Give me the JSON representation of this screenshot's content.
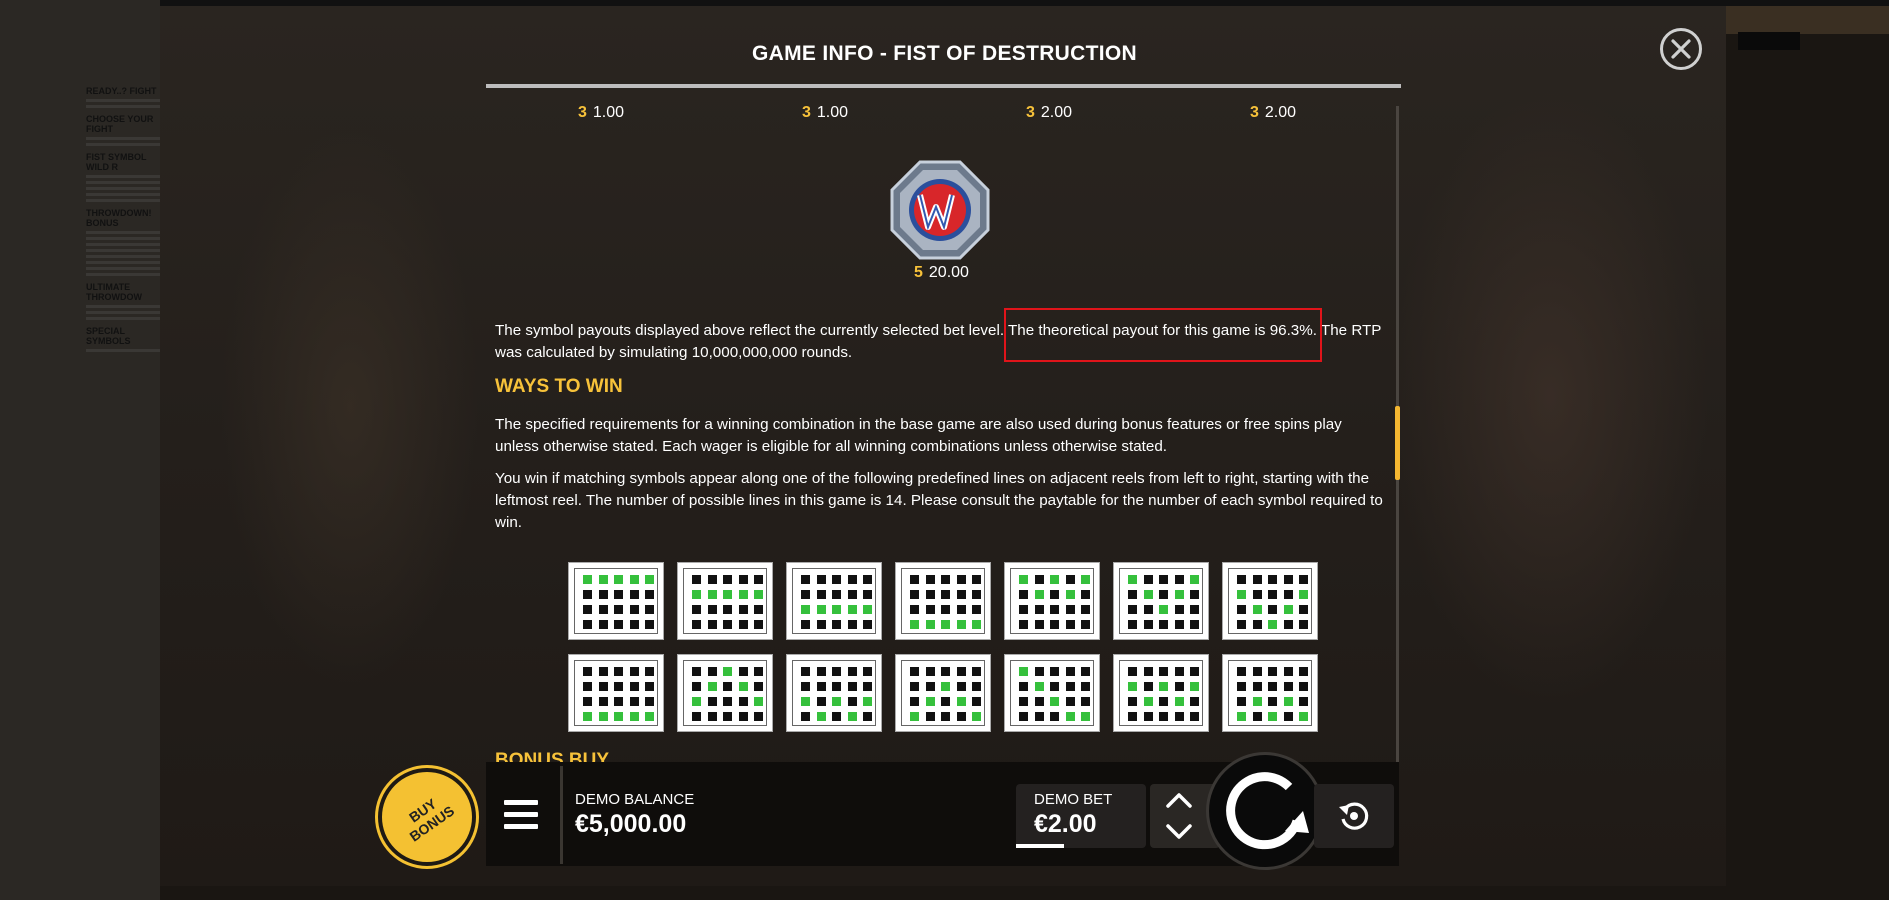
{
  "game_title": "GAME INFO - FIST OF DESTRUCTION",
  "paytable_top": [
    {
      "count": "3",
      "value": "1.00"
    },
    {
      "count": "3",
      "value": "1.00"
    },
    {
      "count": "3",
      "value": "2.00"
    },
    {
      "count": "3",
      "value": "2.00"
    }
  ],
  "wild_payout": {
    "count": "5",
    "value": "20.00"
  },
  "rtp_paragraph": "The symbol payouts displayed above reflect the currently selected bet level. The theoretical payout for this game is 96.3%. The RTP was calculated by simulating 10,000,000,000 rounds.",
  "ways_to_win": {
    "heading": "WAYS TO WIN",
    "para1": "The specified requirements for a winning combination in the base game are also used during bonus features or free spins play unless otherwise stated. Each wager is eligible for all winning combinations unless otherwise stated.",
    "para2": "You win if matching symbols appear along one of the following predefined lines on adjacent reels from left to right, starting with the leftmost reel. The number of possible lines in this game is 14. Please consult the paytable for the number of each symbol required to win."
  },
  "paylines": [
    [
      0,
      0,
      0,
      0,
      0
    ],
    [
      1,
      1,
      1,
      1,
      1
    ],
    [
      2,
      2,
      2,
      2,
      2
    ],
    [
      3,
      3,
      3,
      3,
      3
    ],
    [
      0,
      1,
      0,
      1,
      0
    ],
    [
      0,
      1,
      2,
      1,
      0
    ],
    [
      1,
      2,
      3,
      2,
      1
    ],
    [
      3,
      3,
      3,
      3,
      3
    ],
    [
      2,
      1,
      0,
      1,
      2
    ],
    [
      2,
      3,
      2,
      3,
      2
    ],
    [
      3,
      2,
      1,
      2,
      3
    ],
    [
      0,
      1,
      2,
      3,
      3
    ],
    [
      1,
      2,
      1,
      2,
      1
    ],
    [
      3,
      2,
      3,
      2,
      3
    ]
  ],
  "bonus_buy_heading": "BONUS BUY",
  "buy_bonus_label": "BUY\nBONUS",
  "demo_balance": {
    "label": "DEMO BALANCE",
    "value": "€5,000.00"
  },
  "demo_bet": {
    "label": "DEMO BET",
    "value": "€2.00"
  },
  "background_doc": {
    "heading1": "READY..? FIGHT",
    "heading2": "CHOOSE YOUR FIGHT",
    "heading3": "FIST SYMBOL WILD R",
    "heading4": "THROWDOWN! BONUS",
    "heading5": "ULTIMATE THROWDOW",
    "heading6": "SPECIAL SYMBOLS"
  },
  "colors": {
    "accent": "#f7c23a",
    "highlight": "#e0141a",
    "win_cell": "#35c03c"
  }
}
